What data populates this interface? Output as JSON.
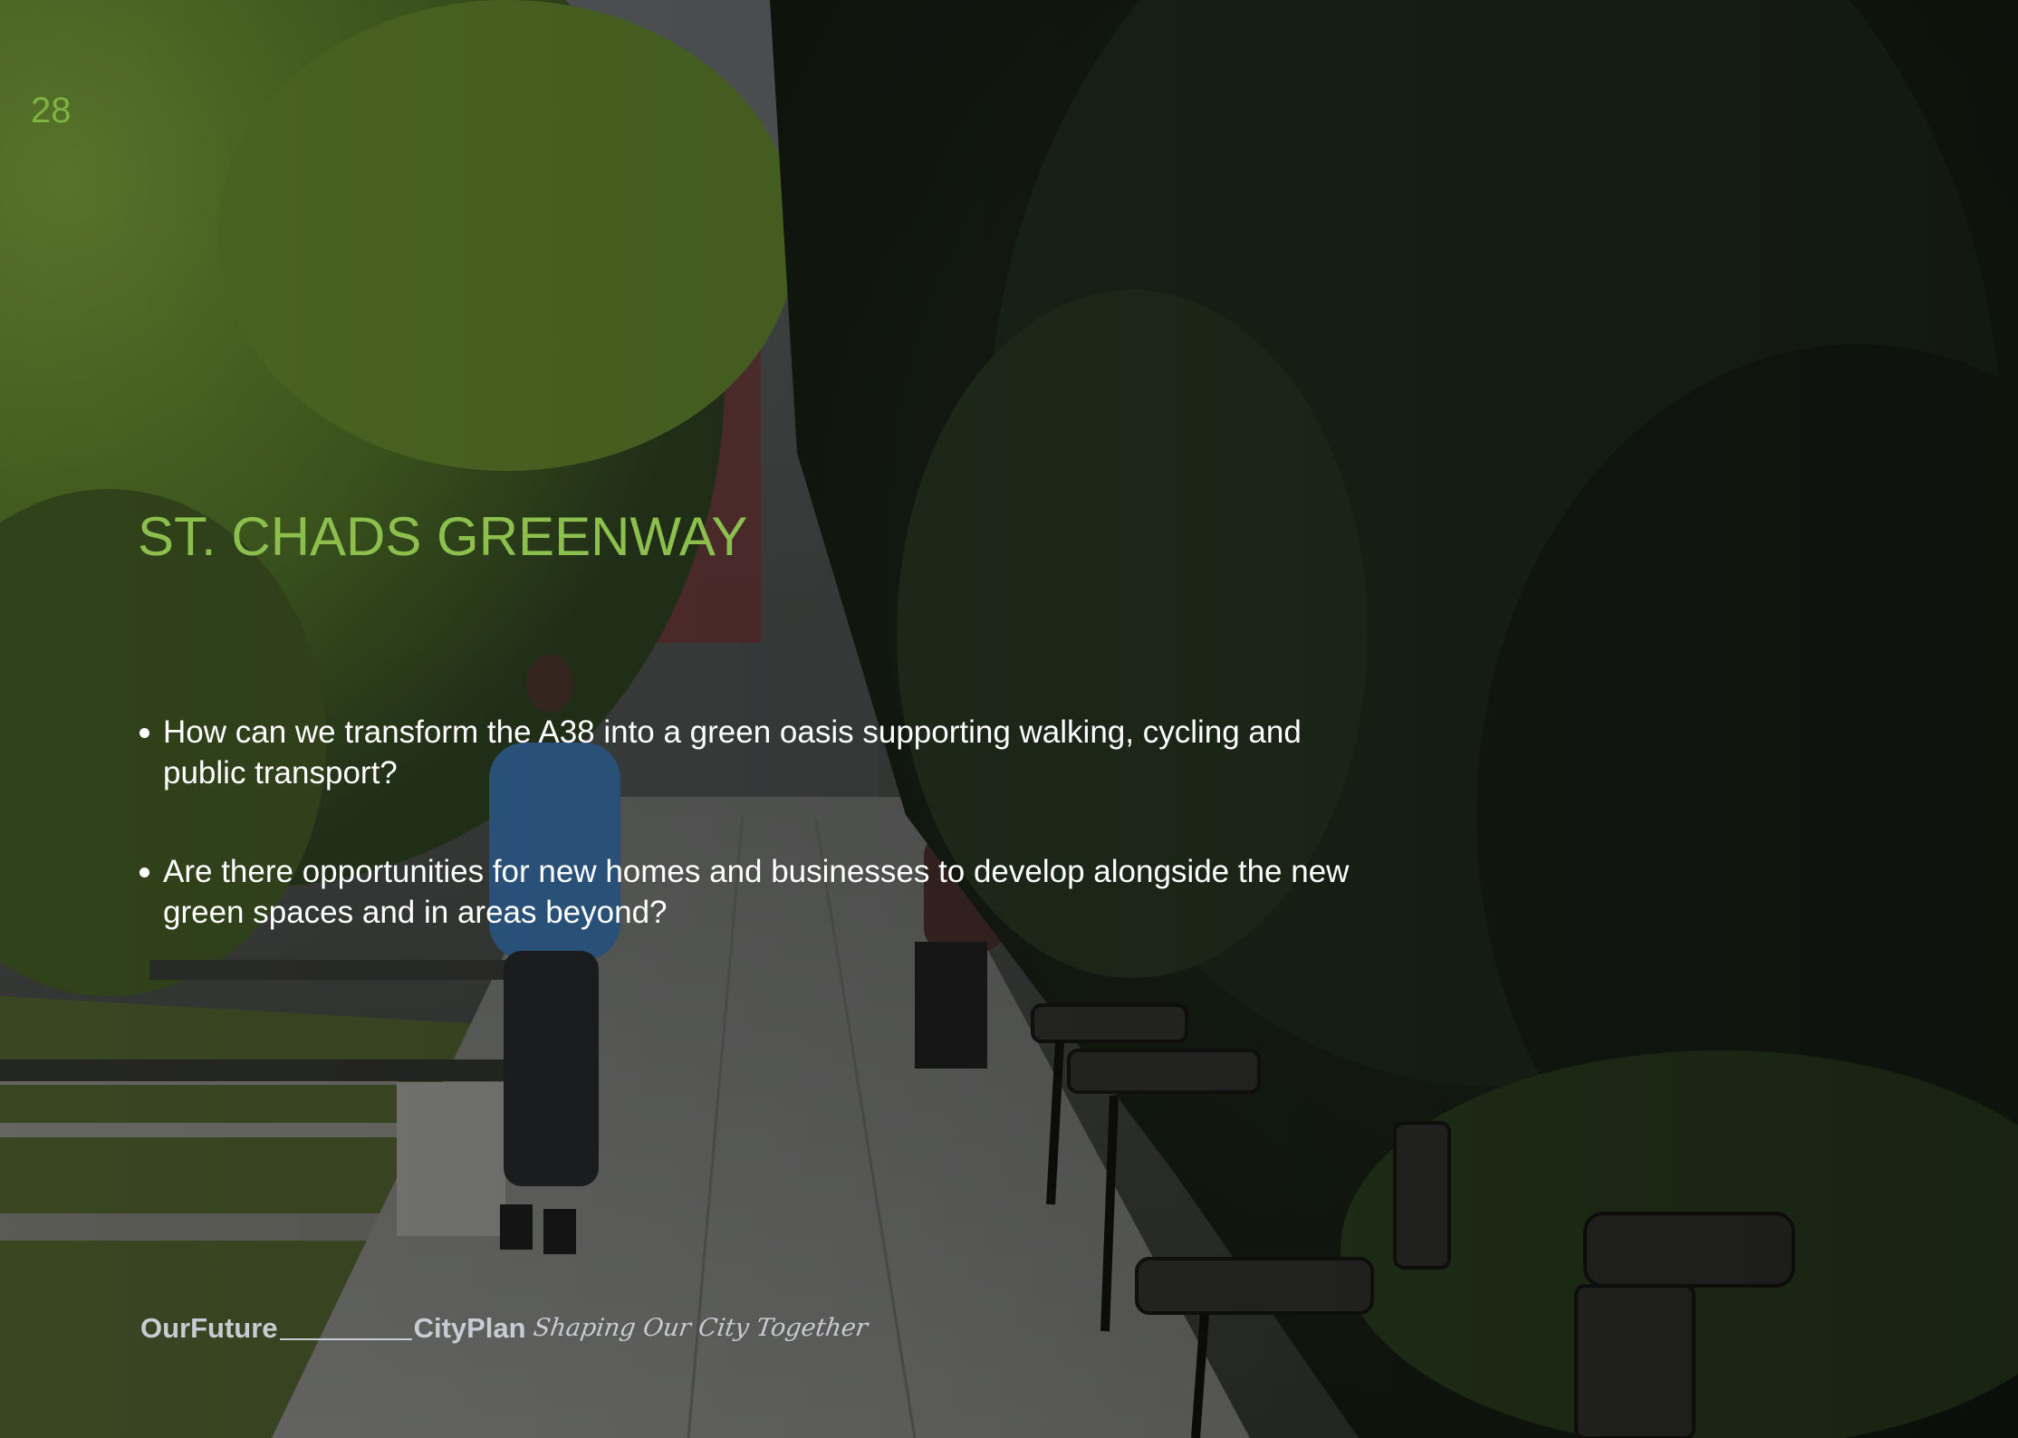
{
  "page": {
    "number": "28",
    "title": "ST. CHADS GREENWAY",
    "bullets": [
      "How can we transform the A38 into a green oasis supporting walking, cycling and public transport?",
      "Are there opportunities for new homes and businesses to develop alongside the new green spaces and in areas beyond?"
    ]
  },
  "footer": {
    "brand_part_1": "OurFuture",
    "brand_part_2": "CityPlan",
    "tagline": "Shaping Our City Together"
  },
  "colors": {
    "accent_green": "#8cbf4e",
    "page_number_green": "#7fb23f",
    "text_white": "#ffffff",
    "brand_grey": "#c7ccd2"
  },
  "background": {
    "image": "park-walkway-photo"
  }
}
